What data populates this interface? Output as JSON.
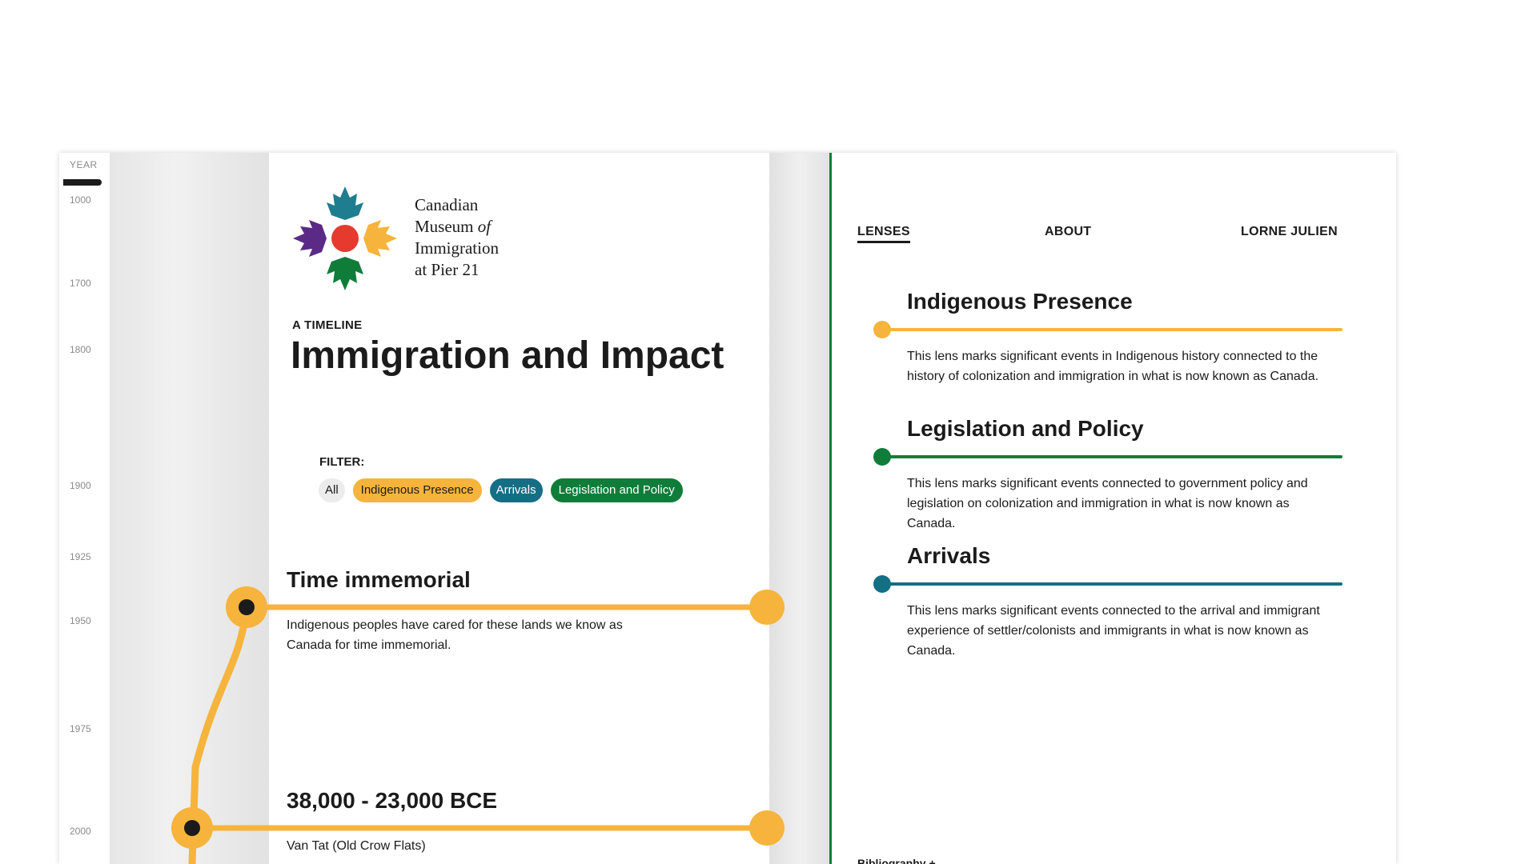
{
  "year_ruler": {
    "label": "YEAR",
    "ticks": [
      "1000",
      "1700",
      "1800",
      "1900",
      "1925",
      "1950",
      "1975",
      "2000"
    ]
  },
  "museum": {
    "name_line1": "Canadian",
    "name_line2a": "Museum ",
    "name_line2b": "of",
    "name_line3": "Immigration",
    "name_line4": "at Pier 21",
    "logo_colors": {
      "teal": "#1e7d8f",
      "orange": "#f6b43c",
      "green": "#0f7d39",
      "purple": "#5b2a86",
      "red": "#e63a2e"
    }
  },
  "header": {
    "kicker": "A TIMELINE",
    "title": "Immigration and Impact"
  },
  "filter": {
    "label": "FILTER:",
    "chips": [
      "All",
      "Indigenous Presence",
      "Arrivals",
      "Legislation and Policy"
    ]
  },
  "events": [
    {
      "title": "Time immemorial",
      "description": "Indigenous peoples have cared for these lands we know as Canada for time immemorial."
    },
    {
      "title": "38,000 - 23,000 BCE",
      "description": "Van Tat (Old Crow Flats)"
    }
  ],
  "nav": {
    "lenses": "LENSES",
    "about": "ABOUT",
    "user": "LORNE JULIEN"
  },
  "lenses": [
    {
      "title": "Indigenous Presence",
      "color": "#f6b43c",
      "description": "This lens marks significant events in Indigenous history connected to the history of colonization and immigration in what is now known as Canada."
    },
    {
      "title": "Legislation and Policy",
      "color": "#0f7d39",
      "description": "This lens marks significant events connected to government policy and legislation on colonization and immigration in what is now known as Canada."
    },
    {
      "title": "Arrivals",
      "color": "#146e84",
      "description": "This lens marks significant events connected to the arrival and immigrant experience of settler/colonists and immigrants in what is now known as Canada."
    }
  ],
  "footer": {
    "bibliography": "Bibliography +"
  },
  "colors": {
    "indigenous": "#f6b43c",
    "legislation": "#0f7d39",
    "arrivals": "#146e84",
    "ink": "#1b1b1b"
  }
}
